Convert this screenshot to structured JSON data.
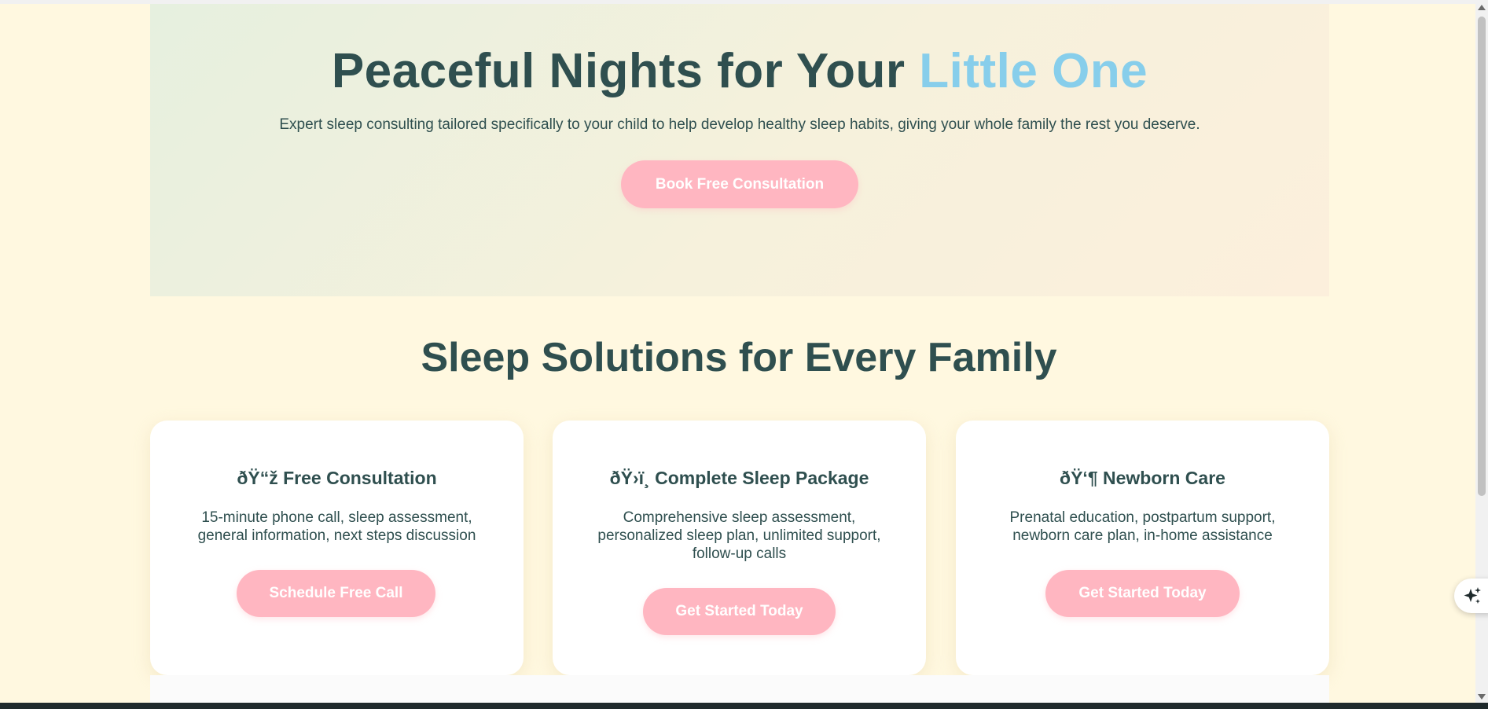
{
  "hero": {
    "title_main": "Peaceful Nights for Your ",
    "title_accent": "Little One",
    "subtitle": "Expert sleep consulting tailored specifically to your child to help develop healthy sleep habits, giving your whole family the rest you deserve.",
    "cta_label": "Book Free Consultation"
  },
  "services": {
    "title": "Sleep Solutions for Every Family",
    "cards": [
      {
        "title": "ðŸ“ž Free Consultation",
        "description": "15-minute phone call, sleep assessment, general information, next steps discussion",
        "button": "Schedule Free Call"
      },
      {
        "title": "ðŸ›ï¸ Complete Sleep Package",
        "description": "Comprehensive sleep assessment, personalized sleep plan, unlimited support, follow-up calls",
        "button": "Get Started Today"
      },
      {
        "title": "ðŸ‘¶ Newborn Care",
        "description": "Prenatal education, postpartum support, newborn care plan, in-home assistance",
        "button": "Get Started Today"
      }
    ]
  },
  "colors": {
    "page_background": "#fff8e0",
    "heading": "#2f4f4f",
    "accent_blue": "#87ceeb",
    "button_pink": "#ffb6c1"
  },
  "icons": {
    "assistant_fab": "sparkle-icon"
  }
}
